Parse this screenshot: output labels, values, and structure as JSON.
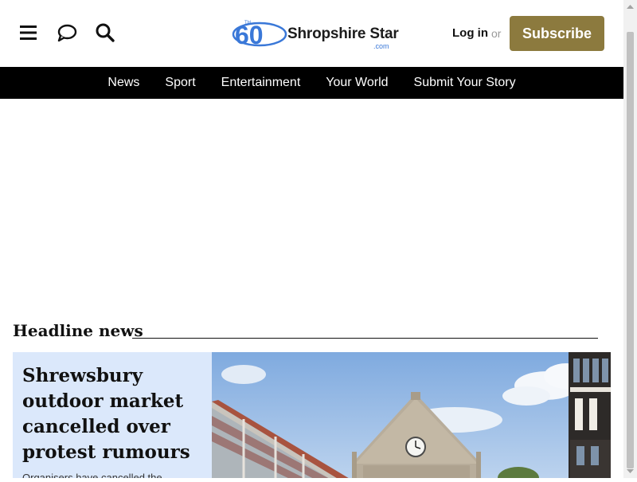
{
  "header": {
    "logo": {
      "anniversary_number": "60",
      "anniversary_small_text": "TH",
      "name": "Shropshire Star",
      "domain": ".com"
    },
    "login_label": "Log in",
    "or_label": "or",
    "subscribe_label": "Subscribe",
    "icons": [
      "menu-icon",
      "comment-icon",
      "search-icon"
    ]
  },
  "nav": {
    "items": [
      {
        "label": "News"
      },
      {
        "label": "Sport"
      },
      {
        "label": "Entertainment"
      },
      {
        "label": "Your World"
      },
      {
        "label": "Submit Your Story"
      }
    ]
  },
  "headline_section": {
    "title": "Headline news",
    "lead_story": {
      "headline": "Shrewsbury outdoor market cancelled over protest rumours",
      "standfirst": "Organisers have cancelled the"
    }
  },
  "colors": {
    "accent": "#8c7a3e",
    "nav_bg": "#000000",
    "lead_panel_bg": "#dbe8fb",
    "logo_blue": "#3a78d8"
  }
}
